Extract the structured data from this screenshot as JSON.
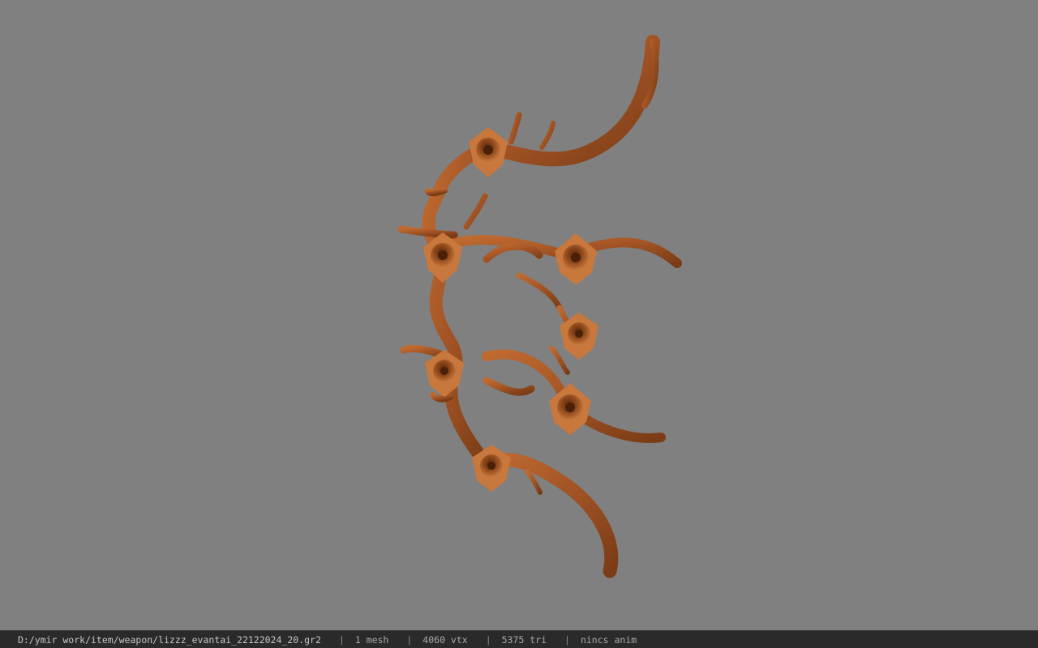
{
  "viewport": {
    "background": "#808080",
    "model_color": "#b0622c",
    "model_dark": "#6a3412",
    "model_light": "#d98a4e"
  },
  "status_bar": {
    "file_path": "D:/ymir work/item/weapon/lizzz_evantai_22122024_20.gr2",
    "separator": "|",
    "mesh_count": "1 mesh",
    "vertex_count": "4060 vtx",
    "triangle_count": "5375 tri",
    "animation": "nincs anim"
  }
}
